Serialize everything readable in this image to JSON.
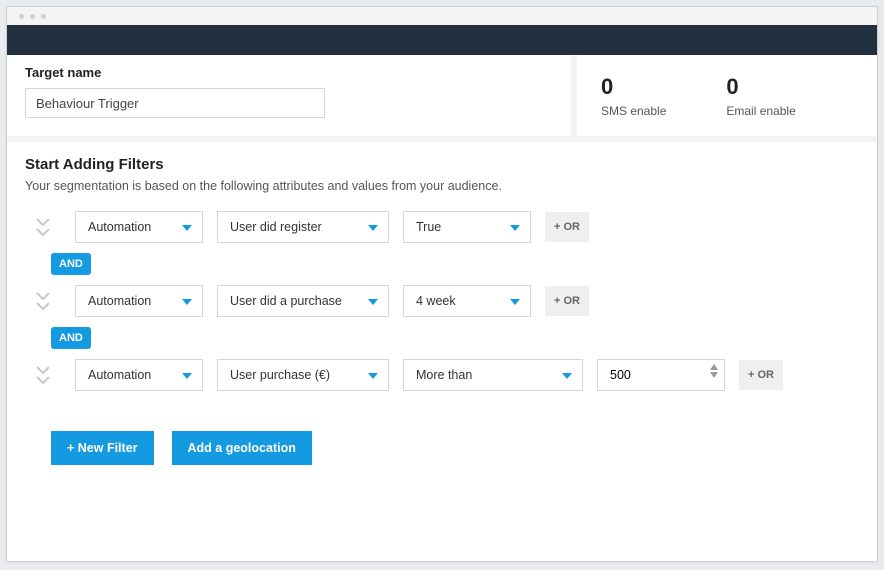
{
  "header": {
    "target_name_label": "Target name",
    "target_name_value": "Behaviour Trigger"
  },
  "stats": {
    "sms": {
      "value": "0",
      "label": "SMS enable"
    },
    "email": {
      "value": "0",
      "label": "Email enable"
    }
  },
  "filters": {
    "title": "Start Adding Filters",
    "subtitle": "Your segmentation is based on the following attributes and values from your audience.",
    "rows": [
      {
        "category": "Automation",
        "attribute": "User did register",
        "condition": "True",
        "value": null,
        "or_label": "+ OR"
      },
      {
        "category": "Automation",
        "attribute": "User did a purchase",
        "condition": "4 week",
        "value": null,
        "or_label": "+ OR"
      },
      {
        "category": "Automation",
        "attribute": "User purchase (€)",
        "condition": "More than",
        "value": "500",
        "or_label": "+ OR"
      }
    ],
    "connectors": {
      "and_label": "AND"
    }
  },
  "actions": {
    "new_filter": "+ New Filter",
    "add_geo": "Add a geolocation"
  },
  "colors": {
    "accent": "#149ae1",
    "navbar": "#22313f"
  }
}
